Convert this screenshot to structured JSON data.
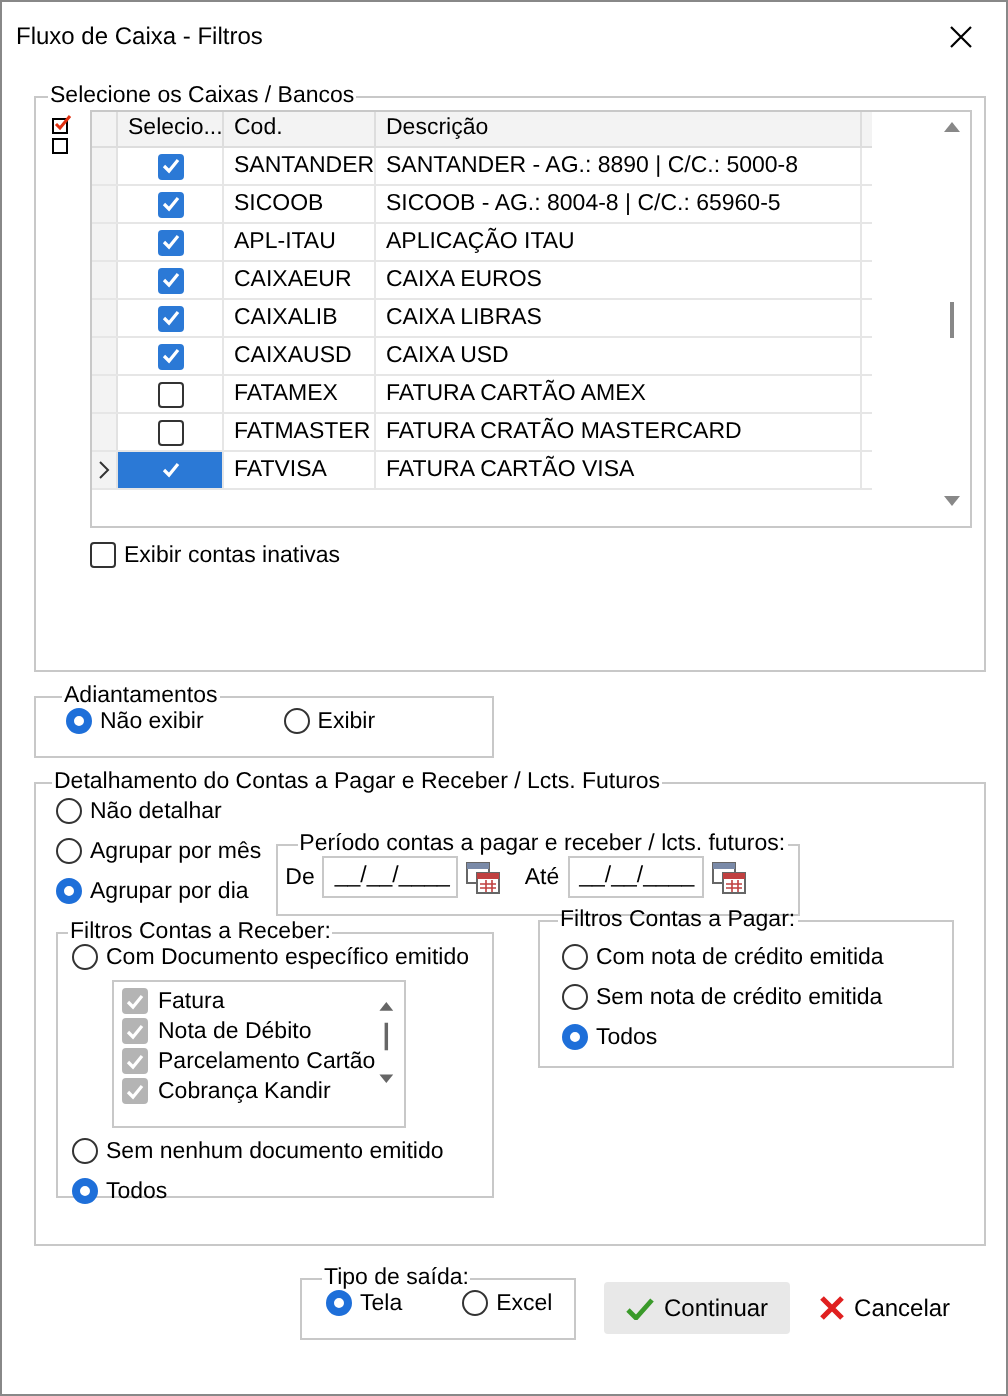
{
  "window": {
    "title": "Fluxo de Caixa - Filtros"
  },
  "accounts": {
    "title": "Selecione os Caixas / Bancos",
    "columns": [
      "Selecio...",
      "Cod.",
      "Descrição"
    ],
    "rows": [
      {
        "code": "SANTANDER",
        "description": "SANTANDER - AG.: 8890 | C/C.: 5000-8",
        "checked": true,
        "selected": false
      },
      {
        "code": "SICOOB",
        "description": "SICOOB - AG.: 8004-8 | C/C.: 65960-5",
        "checked": true,
        "selected": false
      },
      {
        "code": "APL-ITAU",
        "description": "APLICAÇÃO ITAU",
        "checked": true,
        "selected": false
      },
      {
        "code": "CAIXAEUR",
        "description": "CAIXA EUROS",
        "checked": true,
        "selected": false
      },
      {
        "code": "CAIXALIB",
        "description": "CAIXA LIBRAS",
        "checked": true,
        "selected": false
      },
      {
        "code": "CAIXAUSD",
        "description": "CAIXA USD",
        "checked": true,
        "selected": false
      },
      {
        "code": "FATAMEX",
        "description": "FATURA CARTÃO AMEX",
        "checked": false,
        "selected": false
      },
      {
        "code": "FATMASTER",
        "description": "FATURA CRATÃO MASTERCARD",
        "checked": false,
        "selected": false
      },
      {
        "code": "FATVISA",
        "description": "FATURA CARTÃO VISA",
        "checked": true,
        "selected": true
      }
    ],
    "show_inactive": {
      "label": "Exibir contas inativas",
      "checked": false
    }
  },
  "advances": {
    "title": "Adiantamentos",
    "options": [
      {
        "label": "Não exibir",
        "selected": true
      },
      {
        "label": "Exibir",
        "selected": false
      }
    ]
  },
  "detail": {
    "title": "Detalhamento do Contas a Pagar e Receber / Lcts. Futuros",
    "options": [
      {
        "label": "Não detalhar",
        "selected": false
      },
      {
        "label": "Agrupar por mês",
        "selected": false
      },
      {
        "label": "Agrupar por dia",
        "selected": true
      }
    ],
    "period": {
      "title": "Período contas a pagar e receber / lcts. futuros:",
      "from_label": "De",
      "from_value": "__/__/____",
      "to_label": "Até",
      "to_value": "__/__/____"
    },
    "receivable": {
      "title": "Filtros Contas a Receber:",
      "options": [
        {
          "label": "Com Documento específico emitido",
          "selected": false
        },
        {
          "label": "Sem nenhum documento emitido",
          "selected": false
        },
        {
          "label": "Todos",
          "selected": true
        }
      ],
      "documents": {
        "disabled": true,
        "items": [
          {
            "label": "Fatura",
            "checked": true
          },
          {
            "label": "Nota de Débito",
            "checked": true
          },
          {
            "label": "Parcelamento Cartão",
            "checked": true
          },
          {
            "label": "Cobrança Kandir",
            "checked": true
          }
        ]
      }
    },
    "payable": {
      "title": "Filtros Contas a Pagar:",
      "options": [
        {
          "label": "Com nota de crédito emitida",
          "selected": false
        },
        {
          "label": "Sem nota de crédito emitida",
          "selected": false
        },
        {
          "label": "Todos",
          "selected": true
        }
      ]
    }
  },
  "output": {
    "title": "Tipo de saída:",
    "options": [
      {
        "label": "Tela",
        "selected": true
      },
      {
        "label": "Excel",
        "selected": false
      }
    ]
  },
  "buttons": [
    {
      "kind": "confirm",
      "label": "Continuar"
    },
    {
      "kind": "cancel",
      "label": "Cancelar"
    }
  ]
}
